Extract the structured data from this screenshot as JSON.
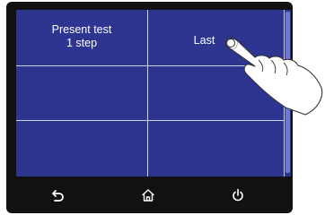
{
  "screen": {
    "cells": [
      {
        "line1": "Present test",
        "line2": "1 step"
      },
      {
        "line1": "Last",
        "line2": ""
      },
      {
        "line1": "",
        "line2": ""
      },
      {
        "line1": "",
        "line2": ""
      },
      {
        "line1": "",
        "line2": ""
      },
      {
        "line1": "",
        "line2": ""
      }
    ]
  },
  "nav": {
    "buttons": [
      {
        "icon": "back-arrow-icon"
      },
      {
        "icon": "home-icon"
      },
      {
        "icon": "power-icon"
      }
    ]
  },
  "colors": {
    "screen_bg": "#2d3591",
    "grid_line": "#cfd3f2",
    "device_bezel": "#111111",
    "text": "#ffffff"
  }
}
